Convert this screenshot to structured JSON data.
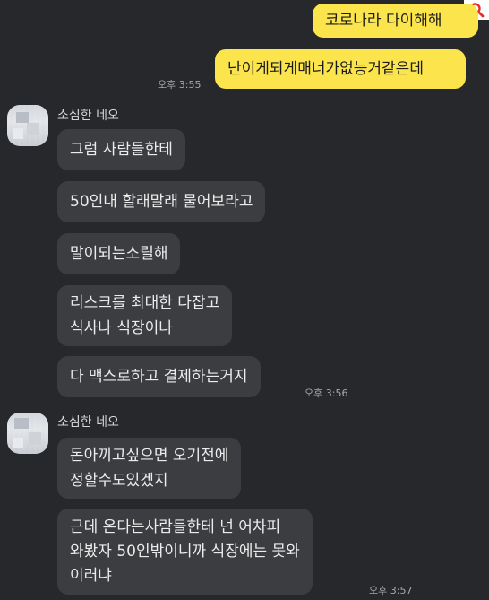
{
  "messages": {
    "me": [
      {
        "text": "코로나라 다이해해"
      },
      {
        "text": "난이게되게매너가없능거같은데"
      }
    ],
    "me_time": "오후 3:55",
    "group1": {
      "sender": "소심한 네오",
      "bubbles": [
        {
          "lines": [
            "그럼 사람들한테"
          ]
        },
        {
          "lines": [
            "50인내 할래말래 물어보라고"
          ]
        },
        {
          "lines": [
            "말이되는소릴해"
          ]
        },
        {
          "lines": [
            "리스크를 최대한 다잡고",
            "식사나 식장이나"
          ]
        },
        {
          "lines": [
            "다 맥스로하고 결제하는거지"
          ]
        }
      ],
      "time": "오후 3:56"
    },
    "group2": {
      "sender": "소심한 네오",
      "bubbles": [
        {
          "lines": [
            "돈아끼고싶으면 오기전에",
            "정할수도있겠지"
          ]
        },
        {
          "lines": [
            "근데 온다는사람들한테 넌 어차피",
            "와봤자 50인밖이니까 식장에는 못와",
            "이러냐"
          ]
        }
      ],
      "time": "오후 3:57"
    }
  },
  "icons": {
    "search": "search-icon"
  },
  "colors": {
    "background": "#26282b",
    "my_bubble": "#fbe44c",
    "other_bubble": "#3c3d40",
    "accent_icon": "#e0312b"
  }
}
